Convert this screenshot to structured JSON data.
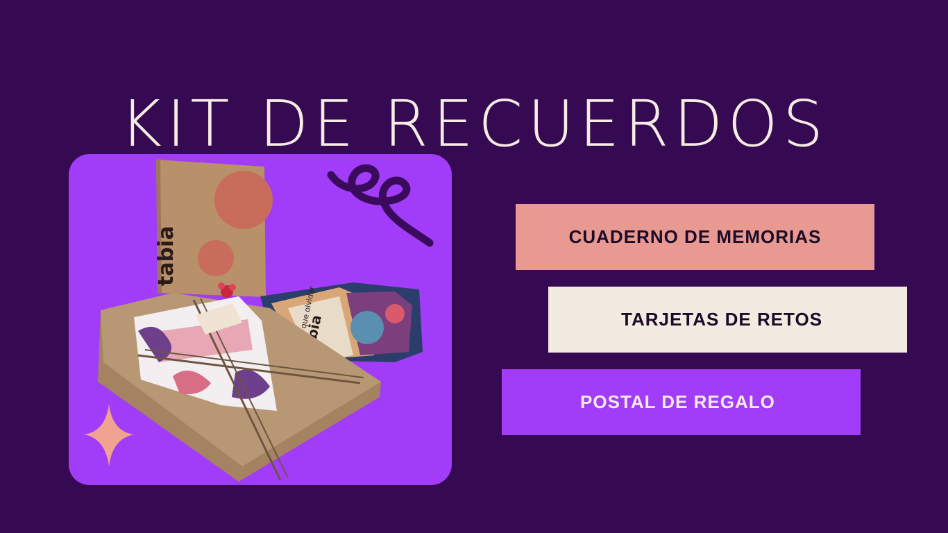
{
  "title": "KIT DE RECUERDOS",
  "items": [
    {
      "label": "CUADERNO DE MEMORIAS"
    },
    {
      "label": "TARJETAS DE RETOS"
    },
    {
      "label": "POSTAL DE REGALO"
    }
  ],
  "photo": {
    "brand_text": "tabia",
    "card_text": "mas que olvidar",
    "icons": [
      "squiggle-icon",
      "sparkle-icon",
      "bow-icon"
    ]
  },
  "colors": {
    "background": "#360a52",
    "accent_purple": "#a13cf9",
    "salmon": "#e89a92",
    "cream": "#f1ebe1",
    "text_light": "#f7ece4"
  }
}
